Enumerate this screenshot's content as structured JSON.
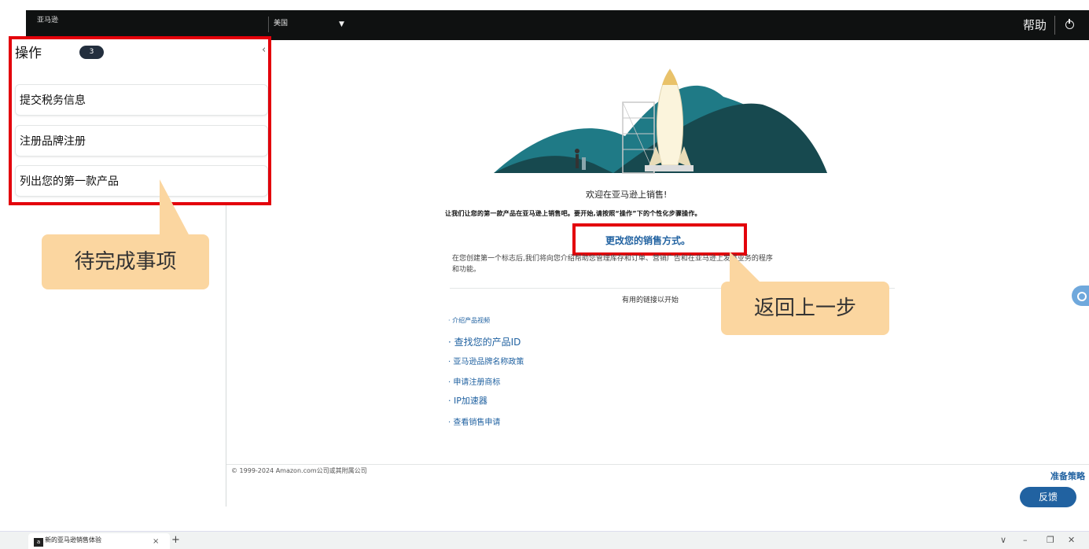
{
  "topbar": {
    "brand": "亚马逊",
    "marketplace": "美国",
    "marketplace_caret": "▼",
    "help_label": "帮助"
  },
  "actions": {
    "title": "操作",
    "badge": "3",
    "collapse_glyph": "‹",
    "tasks": [
      {
        "label": "提交税务信息"
      },
      {
        "label": "注册品牌注册"
      },
      {
        "label": "列出您的第一款产品"
      }
    ]
  },
  "callouts": {
    "left": "待完成事项",
    "right": "返回上一步"
  },
  "main": {
    "welcome": "欢迎在亚马逊上销售!",
    "intro": "让我们让您的第一款产品在亚马逊上销售吧。要开始,请按照“操作”下的个性化步骤操作。",
    "change_link": "更改您的销售方式。",
    "desc_line1": "在您创建第一个标志后,我们将向您介绍帮助您管理库存和订单、营销广告和在亚马逊上发展业务的程序",
    "desc_line2": "和功能。",
    "links_title": "有用的链接以开始",
    "links": [
      {
        "label": "· 介绍产品视频"
      },
      {
        "label": "· 查找您的产品ID"
      },
      {
        "label": "· 亚马逊品牌名称政策"
      },
      {
        "label": "· 申请注册商标"
      },
      {
        "label": "· IP加速器"
      },
      {
        "label": "· 查看销售申请"
      }
    ]
  },
  "footer": {
    "copyright": "© 1999-2024 Amazon.com公司或其附属公司",
    "prep": "准备策略",
    "feedback": "反馈"
  },
  "browser": {
    "tab_icon": "a",
    "tab_title": "新的亚马逊销售体验",
    "tab_close": "×",
    "new_tab": "+",
    "controls": [
      "∨",
      "–",
      "❐",
      "✕"
    ]
  },
  "colors": {
    "nav_bg": "#0f1111",
    "highlight_red": "#e3000b",
    "callout_bg": "#fbd6a0",
    "link_blue": "#2162a1",
    "mountain_teal": "#1f7a86",
    "mountain_dark": "#17494f"
  }
}
